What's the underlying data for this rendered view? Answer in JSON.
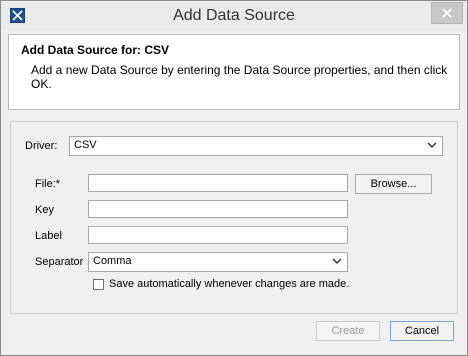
{
  "window": {
    "title": "Add Data Source"
  },
  "header": {
    "title": "Add Data Source for: CSV",
    "description": "Add a new Data Source by entering the Data Source properties, and then click OK."
  },
  "form": {
    "driver_label": "Driver:",
    "driver_value": "CSV",
    "file_label": "File:*",
    "file_value": "",
    "browse_label": "Browse...",
    "key_label": "Key",
    "key_value": "",
    "label_label": "Label",
    "label_value": "",
    "separator_label": "Separator",
    "separator_value": "Comma",
    "autosave_label": "Save automatically whenever changes are made.",
    "autosave_checked": false
  },
  "footer": {
    "create_label": "Create",
    "cancel_label": "Cancel"
  }
}
